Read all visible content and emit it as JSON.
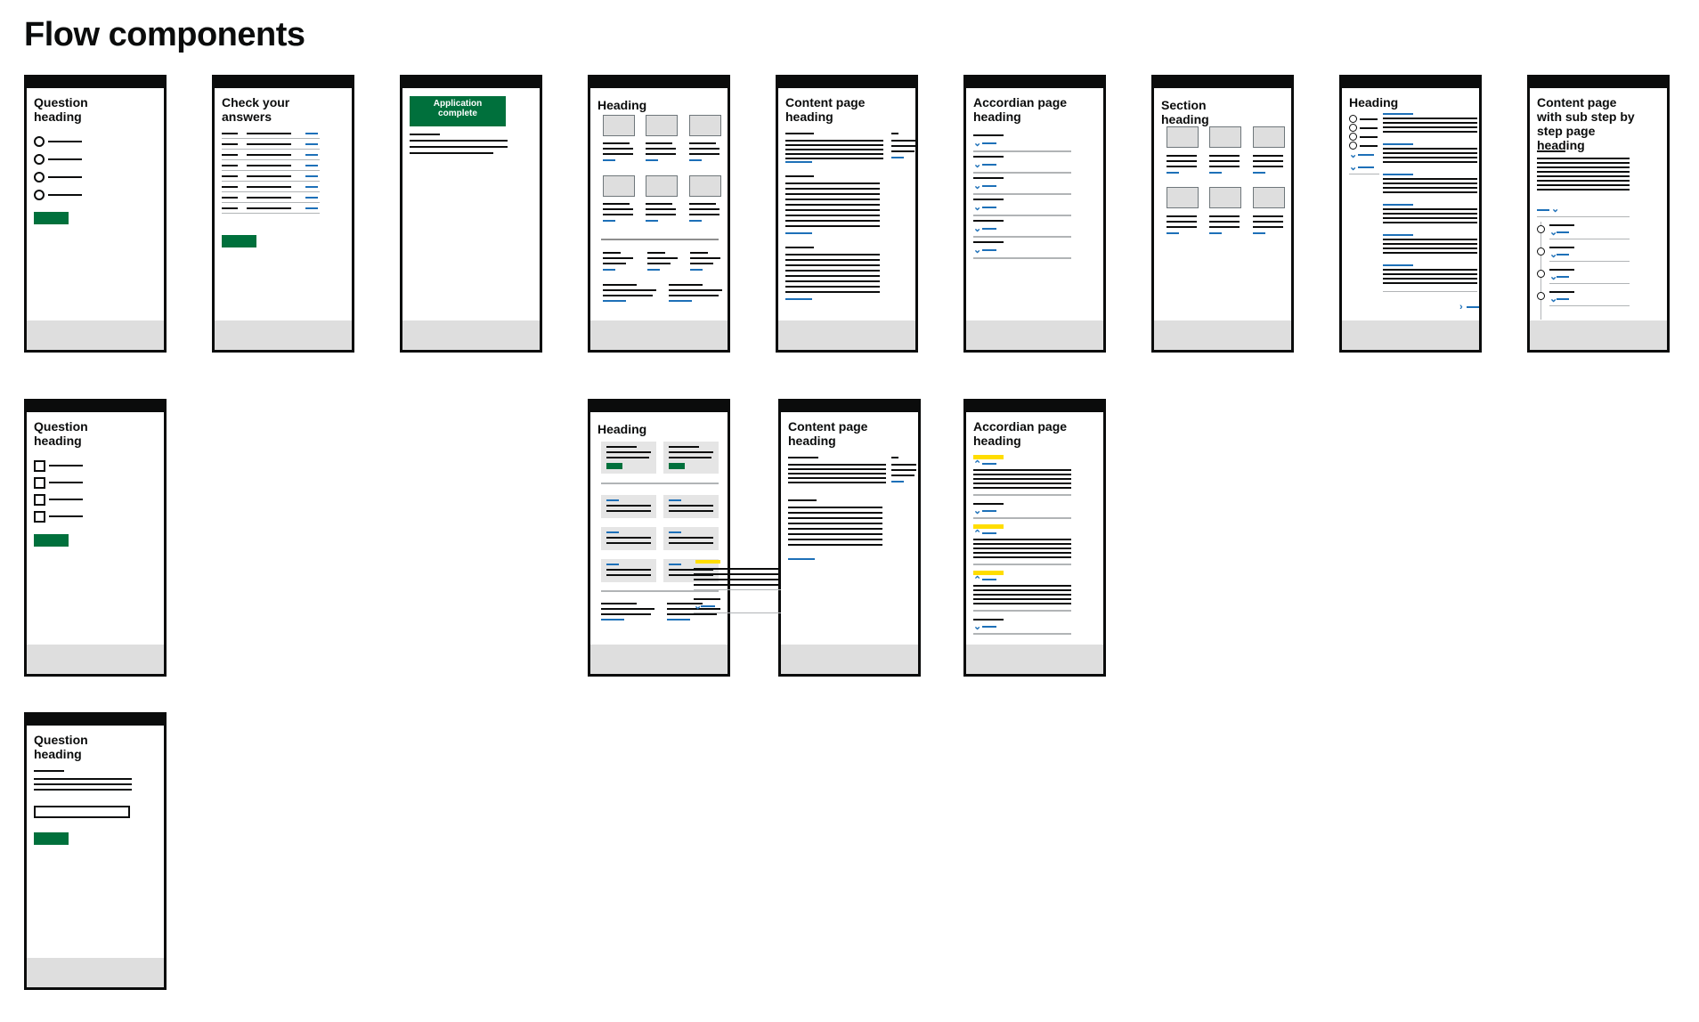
{
  "page": {
    "title": "Flow components"
  },
  "frames": {
    "q_radio": {
      "heading": "Question heading"
    },
    "check_answers": {
      "heading": "Check your answers"
    },
    "confirmation": {
      "panel": "Application complete"
    },
    "grid_page": {
      "heading": "Heading"
    },
    "content_page": {
      "heading": "Content page heading"
    },
    "accordion_page": {
      "heading": "Accordian page heading"
    },
    "section_page": {
      "heading": "Section heading"
    },
    "sidebar_page": {
      "heading": "Heading"
    },
    "step_by_step_page": {
      "heading": "Content page with sub step by step page heading"
    },
    "q_checkbox": {
      "heading": "Question heading"
    },
    "grid_cards_page": {
      "heading": "Heading"
    },
    "content_page_2": {
      "heading": "Content page heading"
    },
    "accordion_open_page": {
      "heading": "Accordian page heading"
    },
    "q_text": {
      "heading": "Question heading"
    }
  },
  "colors": {
    "ink": "#0b0c0c",
    "link": "#1d70b8",
    "button": "#00703c",
    "highlight": "#ffdd00",
    "footer": "#dedede"
  }
}
